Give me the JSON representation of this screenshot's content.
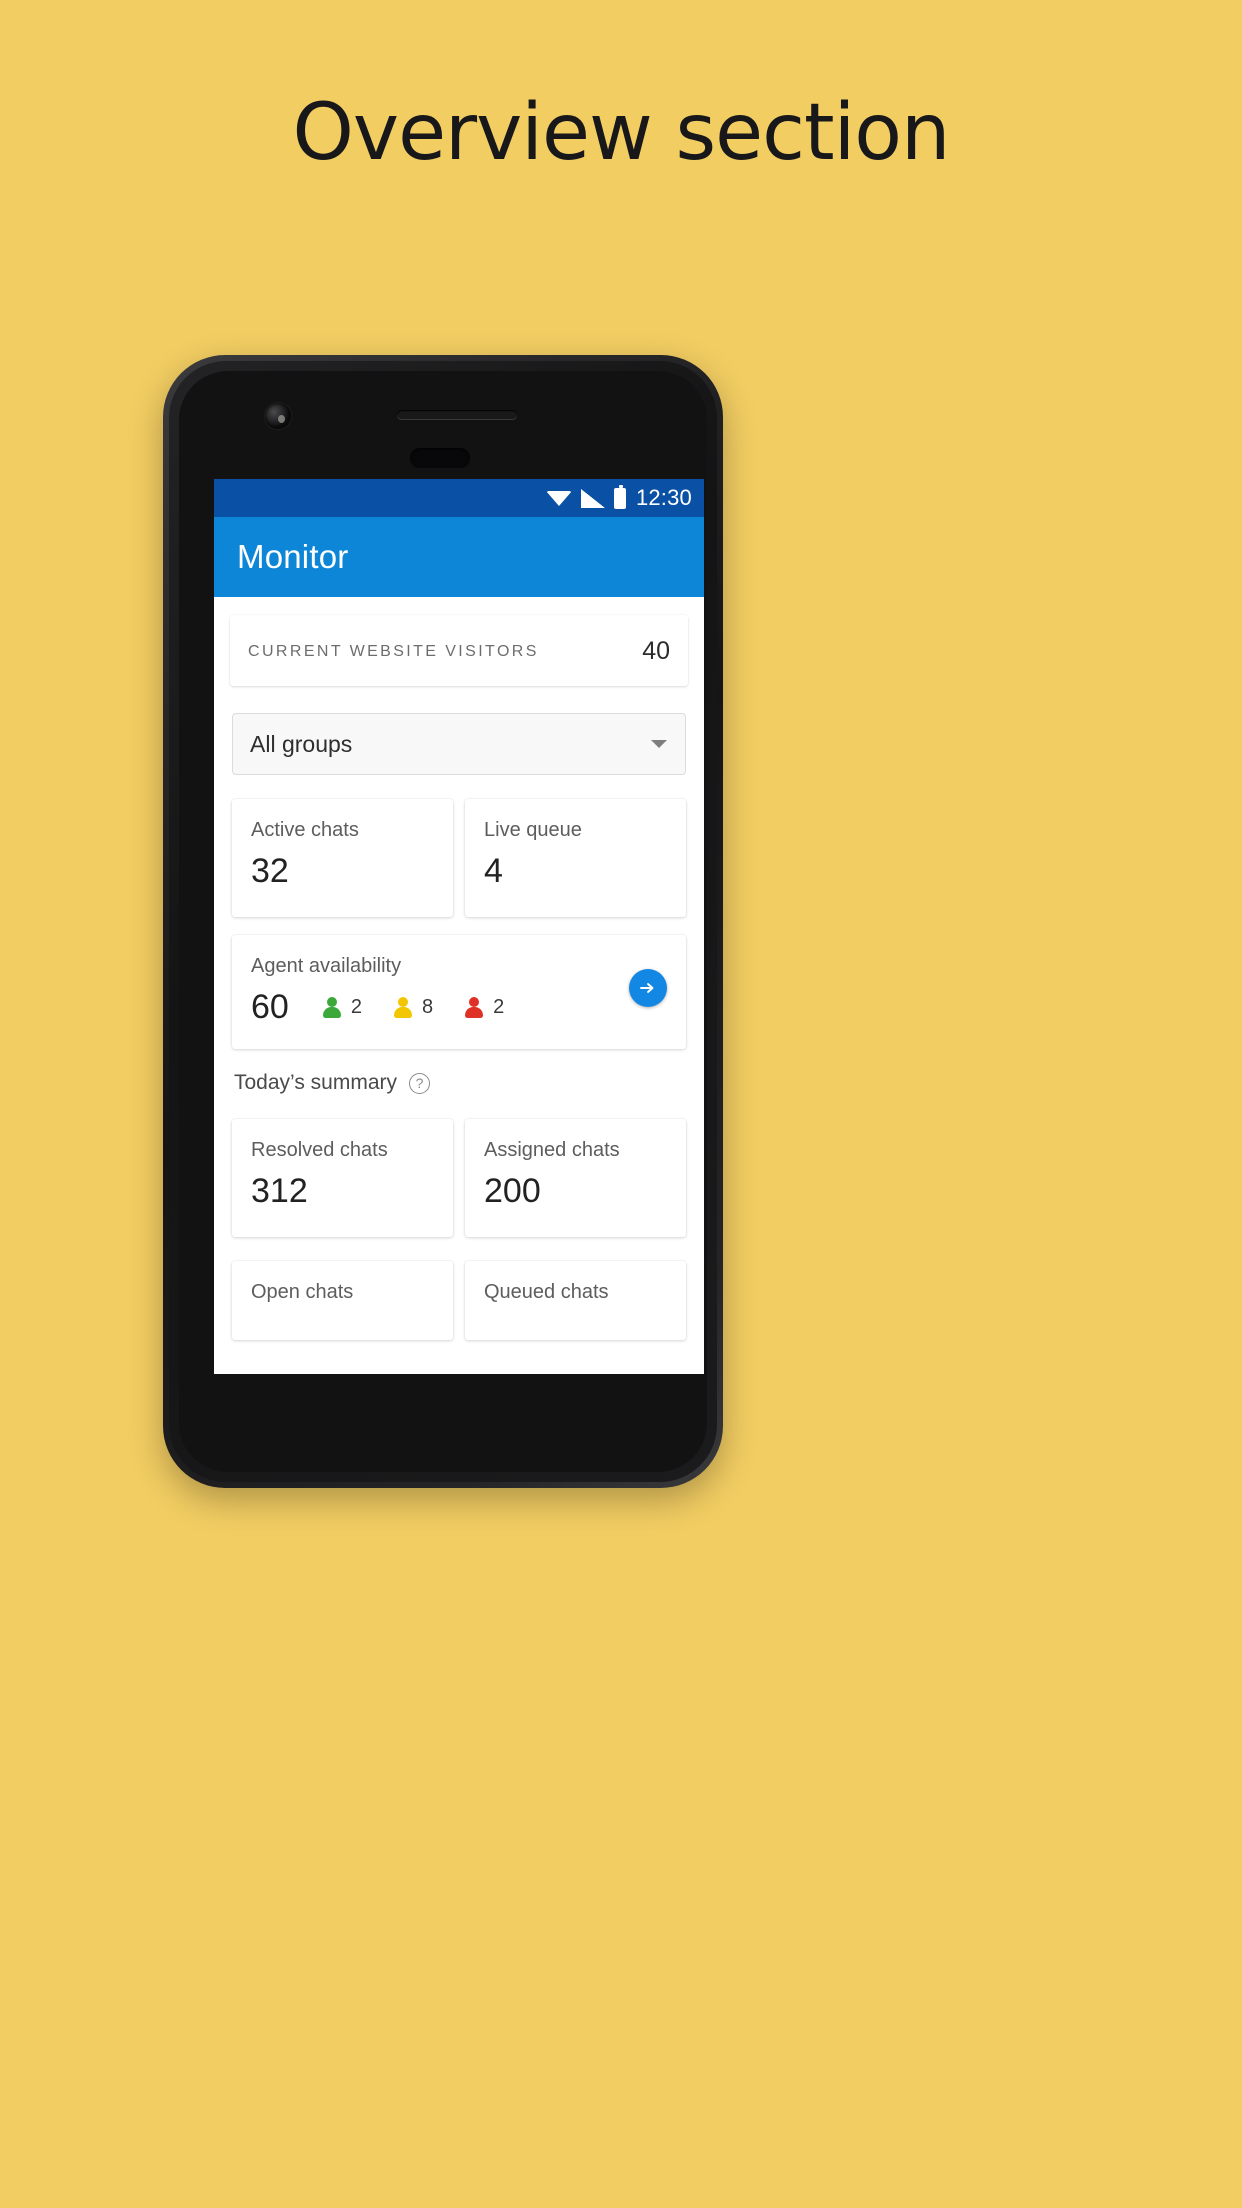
{
  "poster": {
    "title": "Overview section",
    "background_color": "#f2cd62"
  },
  "phone": {
    "statusbar": {
      "time": "12:30",
      "icons": [
        "wifi-icon",
        "signal-icon",
        "battery-icon"
      ],
      "background_color": "#0a51a6"
    },
    "appbar": {
      "title": "Monitor",
      "background_color": "#0d86d8"
    },
    "navbar": {
      "back_label": "back-triangle",
      "home_label": "home-circle",
      "recents_label": "recents-square"
    }
  },
  "content": {
    "visitors": {
      "label": "CURRENT WEBSITE VISITORS",
      "value": "40"
    },
    "group_filter": {
      "value": "All groups"
    },
    "metrics_row1": [
      {
        "label": "Active chats",
        "value": "32"
      },
      {
        "label": "Live queue",
        "value": "4"
      }
    ],
    "agent_availability": {
      "label": "Agent availability",
      "total": "60",
      "statuses": [
        {
          "name": "accepting-chats",
          "color": "#3aa93a",
          "count": "2"
        },
        {
          "name": "not-accepting-chats",
          "color": "#f2c600",
          "count": "8"
        },
        {
          "name": "offline",
          "color": "#e03127",
          "count": "2"
        }
      ],
      "action_icon": "arrow-right-icon",
      "action_color": "#1287e3"
    },
    "todays_summary": {
      "title": "Today’s summary",
      "help_icon": "?"
    },
    "metrics_row2": [
      {
        "label": "Resolved chats",
        "value": "312"
      },
      {
        "label": "Assigned chats",
        "value": "200"
      }
    ],
    "metrics_row3": [
      {
        "label": "Open chats",
        "value": ""
      },
      {
        "label": "Queued chats",
        "value": ""
      }
    ]
  }
}
